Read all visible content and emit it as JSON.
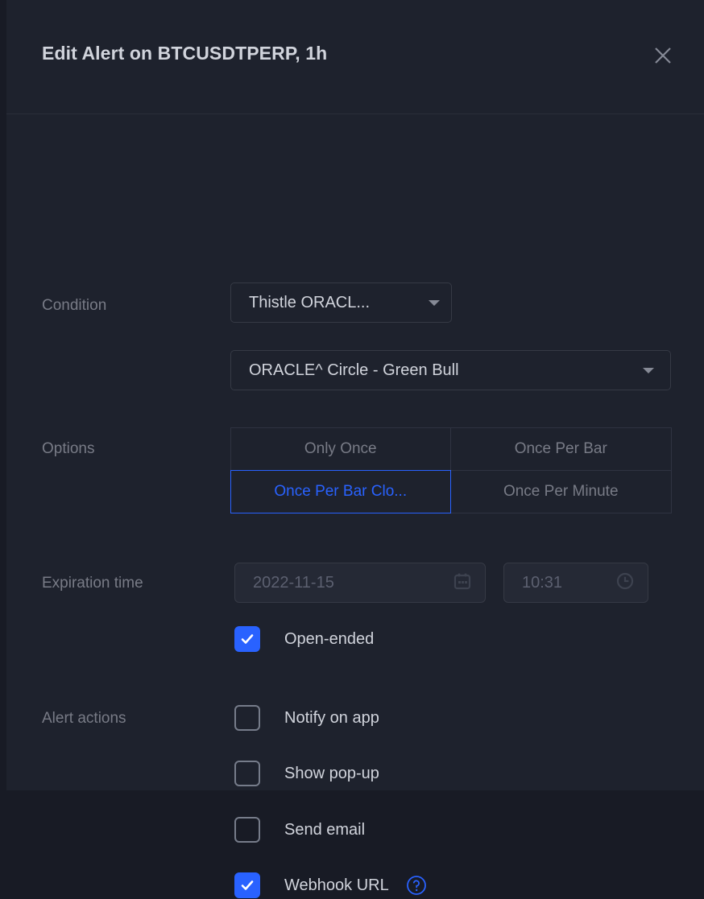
{
  "header": {
    "title": "Edit Alert on BTCUSDTPERP, 1h",
    "close_icon": "close-icon"
  },
  "condition": {
    "label": "Condition",
    "symbol_select": {
      "value": "Thistle ORACL...",
      "caret_icon": "chevron-down-icon"
    },
    "trigger_select": {
      "value": "ORACLE^ Circle - Green Bull",
      "caret_icon": "chevron-down-icon"
    }
  },
  "options": {
    "label": "Options",
    "items": [
      {
        "label": "Only Once",
        "selected": false
      },
      {
        "label": "Once Per Bar",
        "selected": false
      },
      {
        "label": "Once Per Bar Clo...",
        "selected": true
      },
      {
        "label": "Once Per Minute",
        "selected": false
      }
    ]
  },
  "expiration": {
    "label": "Expiration time",
    "date": {
      "value": "2022-11-15",
      "icon": "calendar-icon"
    },
    "time": {
      "value": "10:31",
      "icon": "clock-icon"
    },
    "open_ended": {
      "label": "Open-ended",
      "checked": true
    }
  },
  "alert_actions": {
    "label": "Alert actions",
    "items": [
      {
        "label": "Notify on app",
        "checked": false,
        "help": false
      },
      {
        "label": "Show pop-up",
        "checked": false,
        "help": false
      },
      {
        "label": "Send email",
        "checked": false,
        "help": false
      },
      {
        "label": "Webhook URL",
        "checked": true,
        "help": true
      }
    ]
  },
  "colors": {
    "background": "#1e222d",
    "accent": "#2962ff",
    "text_primary": "#d1d4dc",
    "text_muted": "#787b86",
    "border": "#363a45"
  }
}
